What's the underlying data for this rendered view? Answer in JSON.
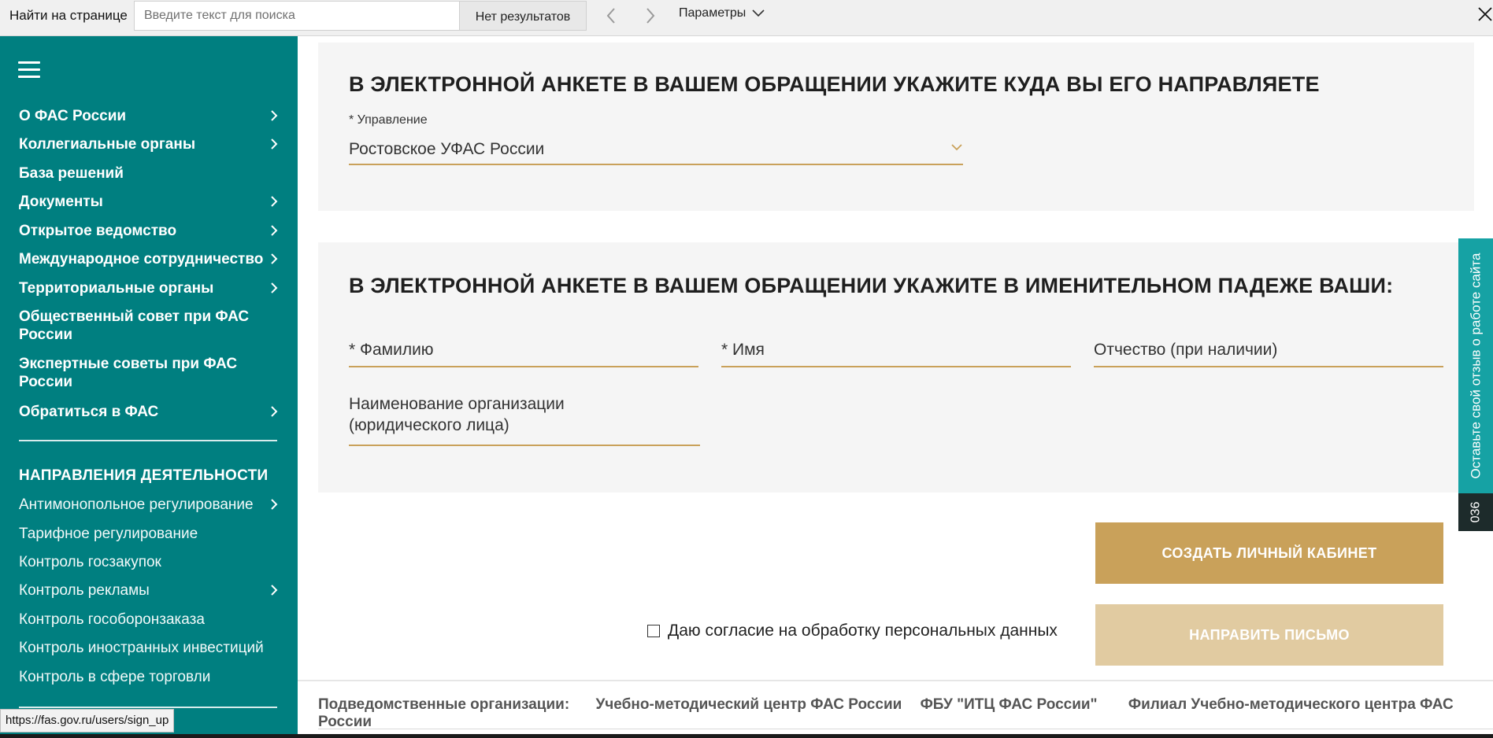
{
  "find_bar": {
    "label": "Найти на странице",
    "placeholder": "Введите текст для поиска",
    "results": "Нет результатов",
    "params_label": "Параметры"
  },
  "sidebar": {
    "items": [
      {
        "label": "О ФАС России",
        "has_arrow": true
      },
      {
        "label": "Коллегиальные органы",
        "has_arrow": true
      },
      {
        "label": "База решений",
        "has_arrow": false
      },
      {
        "label": "Документы",
        "has_arrow": true
      },
      {
        "label": "Открытое ведомство",
        "has_arrow": true
      },
      {
        "label": "Международное сотрудничество",
        "has_arrow": true
      },
      {
        "label": "Территориальные органы",
        "has_arrow": true
      },
      {
        "label": "Общественный совет при ФАС России",
        "has_arrow": false
      },
      {
        "label": "Экспертные советы при ФАС России",
        "has_arrow": false
      },
      {
        "label": "Обратиться в ФАС",
        "has_arrow": true
      }
    ],
    "section_title": "НАПРАВЛЕНИЯ ДЕЯТЕЛЬНОСТИ",
    "directions": [
      {
        "label": "Антимонопольное регулирование",
        "has_arrow": true
      },
      {
        "label": "Тарифное регулирование",
        "has_arrow": false
      },
      {
        "label": "Контроль госзакупок",
        "has_arrow": false
      },
      {
        "label": "Контроль рекламы",
        "has_arrow": true
      },
      {
        "label": "Контроль гособоронзаказа",
        "has_arrow": false
      },
      {
        "label": "Контроль иностранных инвестиций",
        "has_arrow": false
      },
      {
        "label": "Контроль в сфере торговли",
        "has_arrow": false
      }
    ]
  },
  "form": {
    "section1_title": "В ЭЛЕКТРОННОЙ АНКЕТЕ В ВАШЕМ ОБРАЩЕНИИ УКАЖИТЕ КУДА ВЫ ЕГО НАПРАВЛЯЕТЕ",
    "management_label": "* Управление",
    "management_value": "Ростовское УФАС России",
    "section2_title": "В ЭЛЕКТРОННОЙ АНКЕТЕ В ВАШЕМ ОБРАЩЕНИИ УКАЖИТЕ В ИМЕНИТЕЛЬНОМ ПАДЕЖЕ ВАШИ:",
    "surname_placeholder": "* Фамилию",
    "name_placeholder": "* Имя",
    "patronymic_placeholder": "Отчество (при наличии)",
    "organization_line1": "Наименование организации",
    "organization_line2": "(юридического лица)",
    "create_button": "СОЗДАТЬ ЛИЧНЫЙ КАБИНЕТ",
    "consent_label": "Даю согласие на обработку персональных данных",
    "send_button": "НАПРАВИТЬ ПИСЬМО"
  },
  "feedback": {
    "label": "Оставьте свой отзыв о работе сайта",
    "counter": "036"
  },
  "footer": {
    "label": "Подведомственные организации:",
    "links": [
      "Учебно-методический центр ФАС России",
      "ФБУ \"ИТЦ ФАС России\"",
      "Филиал Учебно-методического центра ФАС России"
    ]
  },
  "status_url": "https://fas.gov.ru/users/sign_up",
  "colors": {
    "sidebar": "#007f80",
    "accent_gold": "#c9a15a",
    "gold_light": "#e1cba1",
    "feedback_teal": "#16a2a4"
  }
}
